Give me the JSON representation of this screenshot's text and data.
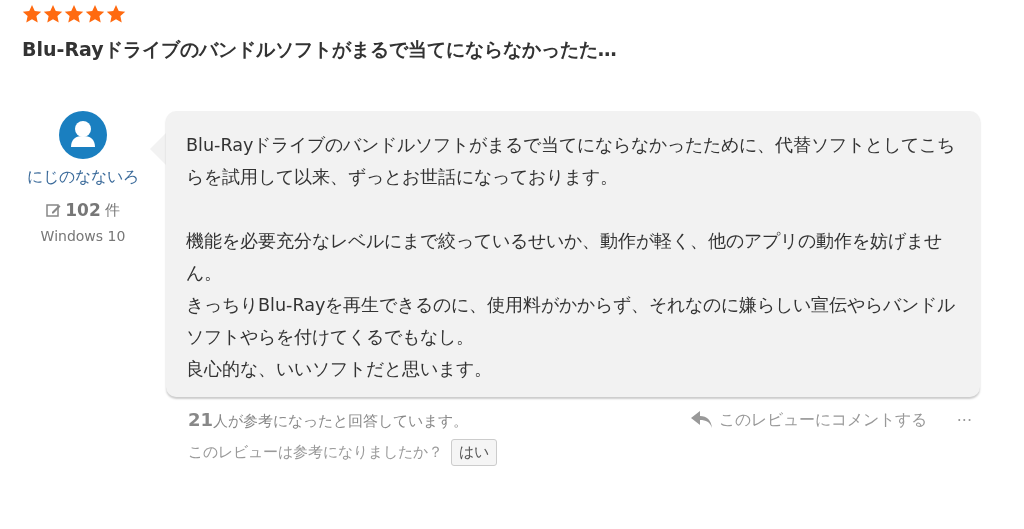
{
  "review": {
    "stars": 5,
    "title": "Blu-Rayドライブのバンドルソフトがまるで当てにならなかったた…",
    "author": {
      "name": "にじのなないろ",
      "review_count": "102",
      "count_unit": "件",
      "os": "Windows 10"
    },
    "body": [
      [
        "Blu-Rayドライブのバンドルソフトがまるで当てにならなかったために、代替ソフトとしてこちらを試用して以来、ずっとお世話になっております。"
      ],
      [
        "機能を必要充分なレベルにまで絞っているせいか、動作が軽く、他のアプリの動作を妨げません。",
        "きっちりBlu-Rayを再生できるのに、使用料がかからず、それなのに嫌らしい宣伝やらバンドルソフトやらを付けてくるでもなし。",
        "良心的な、いいソフトだと思います。"
      ]
    ],
    "helpful": {
      "count": "21",
      "text": "人が参考になったと回答しています。"
    },
    "comment_link": "このレビューにコメントする",
    "more": "···",
    "question": "このレビューは参考になりましたか？",
    "yes_button": "はい"
  }
}
